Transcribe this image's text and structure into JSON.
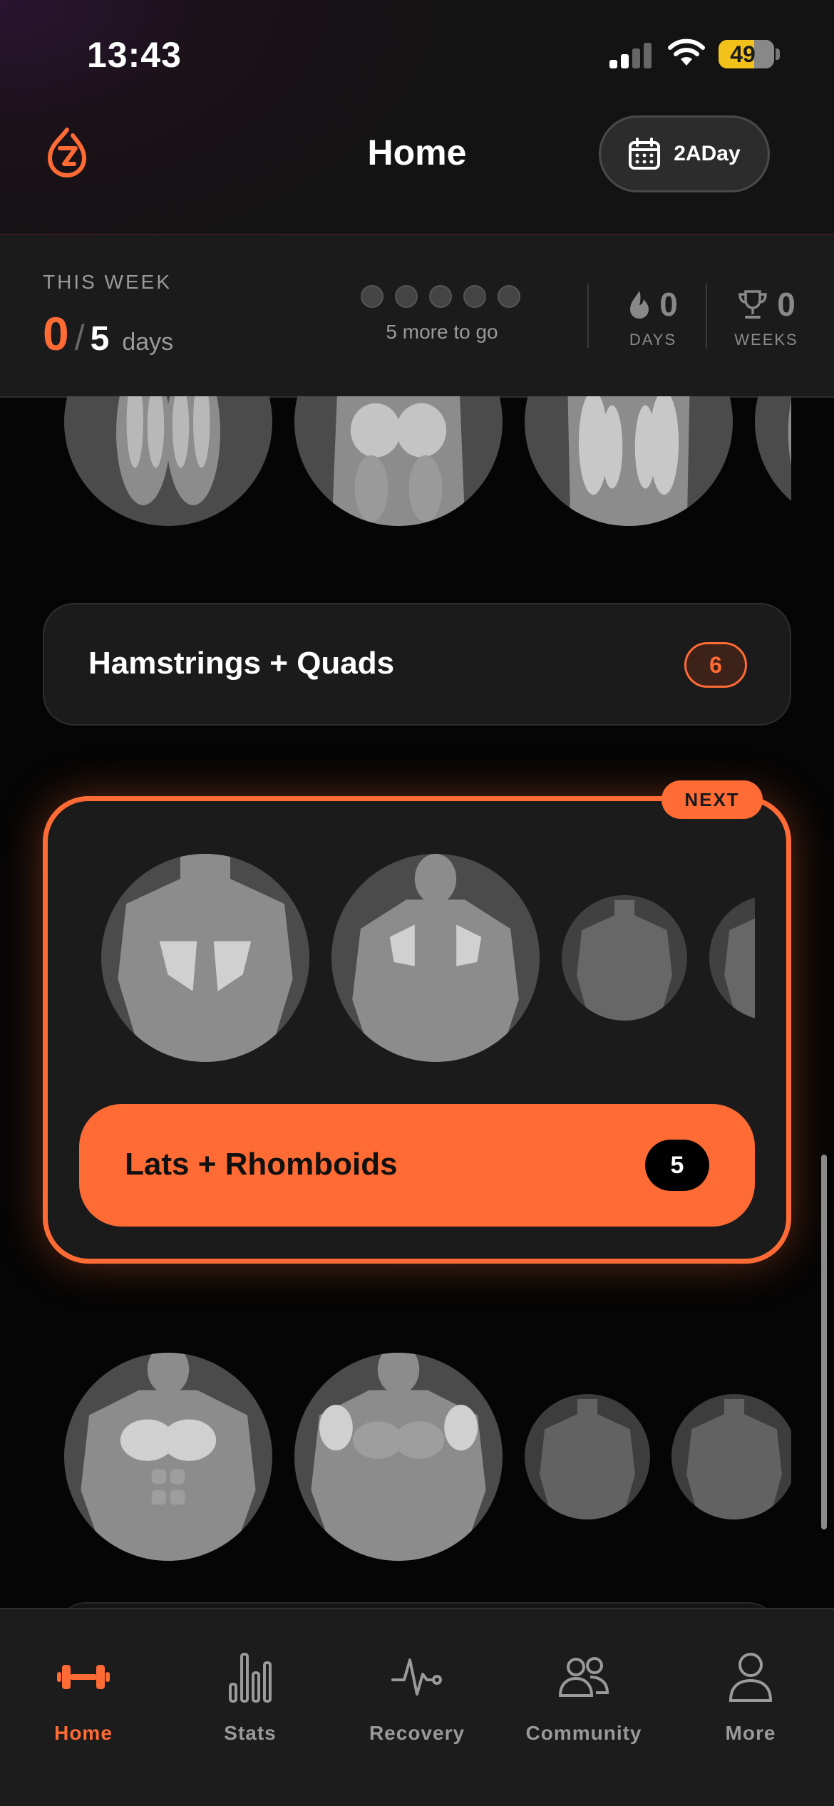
{
  "status_bar": {
    "time": "13:43",
    "battery": "49"
  },
  "header": {
    "title": "Home",
    "plan_button_label": "2ADay"
  },
  "week_summary": {
    "label": "THIS WEEK",
    "completed": "0",
    "separator": "/",
    "goal": "5",
    "unit": "days",
    "progress_dots": [
      false,
      false,
      false,
      false,
      false
    ],
    "remaining_text": "5 more to go",
    "streak_days": {
      "value": "0",
      "label": "DAYS"
    },
    "streak_weeks": {
      "value": "0",
      "label": "WEEKS"
    }
  },
  "workouts": [
    {
      "name": "Hamstrings + Quads",
      "exercise_count": "6"
    },
    {
      "name": "Lats + Rhomboids",
      "exercise_count": "5",
      "tag": "NEXT"
    }
  ],
  "tab_bar": {
    "items": [
      {
        "label": "Home",
        "icon": "dumbbell-icon",
        "active": true
      },
      {
        "label": "Stats",
        "icon": "bar-chart-icon",
        "active": false
      },
      {
        "label": "Recovery",
        "icon": "heartbeat-icon",
        "active": false
      },
      {
        "label": "Community",
        "icon": "people-icon",
        "active": false
      },
      {
        "label": "More",
        "icon": "person-icon",
        "active": false
      }
    ]
  },
  "colors": {
    "accent": "#ff6b35",
    "background": "#050505",
    "card": "#1b1b1b"
  }
}
